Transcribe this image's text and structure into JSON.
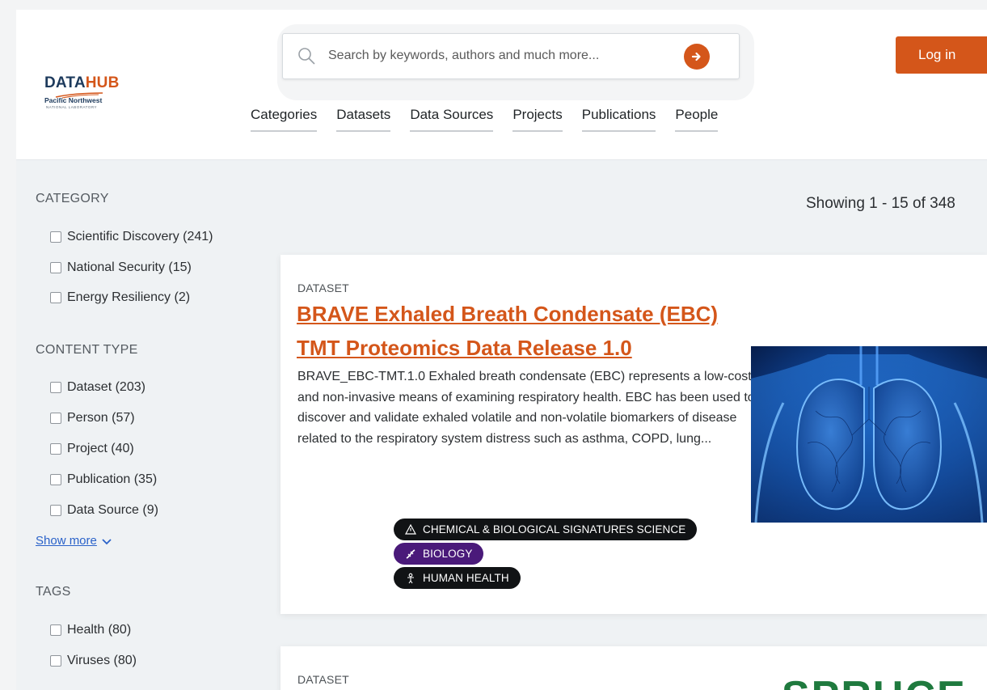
{
  "brand": {
    "logo_primary": "DATA",
    "logo_accent": "HUB",
    "logo_sub": "Pacific Northwest",
    "logo_sub2": "NATIONAL LABORATORY",
    "accent_color": "#d4561a",
    "navy_color": "#1d3a5c"
  },
  "search": {
    "placeholder": "Search by keywords, authors and much more...",
    "icon": "search-icon",
    "submit_icon": "arrow-right-icon"
  },
  "nav": {
    "items": [
      "Categories",
      "Datasets",
      "Data Sources",
      "Projects",
      "Publications",
      "People"
    ]
  },
  "header": {
    "login_label": "Log in"
  },
  "sidebar": {
    "category_heading": "CATEGORY",
    "categories": [
      "Scientific Discovery (241)",
      "National Security (15)",
      "Energy Resiliency (2)"
    ],
    "content_type_heading": "CONTENT TYPE",
    "content_types": [
      "Dataset (203)",
      "Person (57)",
      "Project (40)",
      "Publication (35)",
      "Data Source (9)"
    ],
    "show_more": "Show more",
    "tags_heading": "TAGS",
    "tags": [
      "Health (80)",
      "Viruses (80)"
    ]
  },
  "results": {
    "count_text": "Showing 1 - 15 of 348"
  },
  "cards": [
    {
      "type": "DATASET",
      "title": "BRAVE Exhaled Breath Condensate (EBC) TMT Proteomics Data Release 1.0",
      "description": "BRAVE_EBC-TMT.1.0 Exhaled breath condensate (EBC) represents a low-cost and non-invasive means of examining respiratory health. EBC has been used to discover and validate exhaled volatile and non-volatile biomarkers of disease related to the respiratory system distress such as asthma, COPD, lung...",
      "tags": [
        {
          "label": "CHEMICAL & BIOLOGICAL SIGNATURES SCIENCE",
          "icon": "warning-triangle-icon",
          "color": "#111315"
        },
        {
          "label": "BIOLOGY",
          "icon": "dna-icon",
          "color": "#4a1a7a"
        },
        {
          "label": "HUMAN HEALTH",
          "icon": "human-body-icon",
          "color": "#111315"
        }
      ]
    },
    {
      "type": "DATASET",
      "logo_text": "SPRUCE"
    }
  ]
}
